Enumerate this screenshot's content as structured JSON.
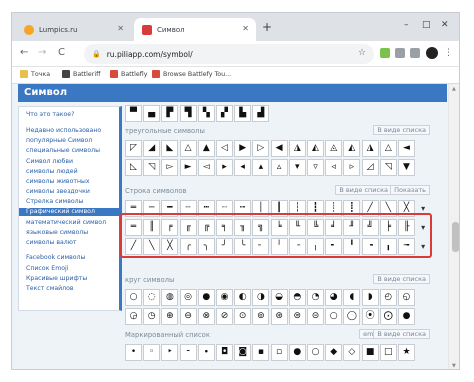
{
  "browser": {
    "tabs": [
      {
        "title": "Lumpics.ru",
        "color": "#f5a623"
      },
      {
        "title": "Символ",
        "color": "#d93a3a"
      }
    ],
    "new_tab": "+",
    "window_controls": [
      "–",
      "□",
      "✕"
    ],
    "close_tab": "✕",
    "nav": {
      "back": "←",
      "forward": "→",
      "reload": "C"
    },
    "address": "ru.piliapp.com/symbol/",
    "bookmarks": [
      "Точка",
      "Battleriff",
      "Battlefly",
      "Browse Battlefy Tou..."
    ]
  },
  "page": {
    "header": "Символ",
    "sidebar": [
      "Что это такое?",
      "Недавно использовано",
      "популярные Символ",
      "специальные символы",
      "Символ любви",
      "символы людей",
      "символы животных",
      "символы звездочки",
      "Стрелка символы",
      "Графический символ",
      "математический символ",
      "языковые символы",
      "символы валют",
      "Facebook символы",
      "Список Emoji",
      "Красивые шрифты",
      "Текст смайлов"
    ],
    "active_sidebar_index": 9,
    "sections": {
      "top": {
        "row": [
          "▀",
          "▄",
          "▛",
          "▜",
          "▚",
          "▞",
          "▙",
          "▟",
          "",
          "",
          "",
          "",
          "",
          "",
          "",
          ""
        ]
      },
      "triangles": {
        "title": "треугольные символы",
        "button": "В виде списка",
        "rows": [
          [
            "◸",
            "◢",
            "◣",
            "△",
            "▲",
            "◁",
            "▶",
            "▷",
            "◀",
            "◮",
            "◭",
            "◬",
            "◭",
            "◮",
            "△",
            "◄"
          ],
          [
            "◺",
            "◹",
            "▻",
            "►",
            "◅",
            "▸",
            "◂",
            "▴",
            "▵",
            "▾",
            "▿",
            "◃",
            "▹",
            "◿",
            "◹",
            "▼"
          ]
        ]
      },
      "lines": {
        "title": "Строка символов",
        "buttons": [
          "В виде списка",
          "Показать"
        ],
        "rows": [
          [
            "═",
            "─",
            "━",
            "┄",
            "┅",
            "┈",
            "┉",
            "│",
            "┃",
            "┆",
            "┇",
            "┊",
            "┋",
            "╱",
            "╲",
            "╳"
          ],
          [
            "═",
            "║",
            "╒",
            "╓",
            "╔",
            "╕",
            "╖",
            "╗",
            "╘",
            "╙",
            "╚",
            "╛",
            "╜",
            "╝",
            "╞",
            "╟"
          ],
          [
            "╱",
            "╲",
            "╳",
            "╭",
            "╮",
            "╯",
            "╰",
            "╴",
            "╵",
            "╶",
            "╷",
            "╸",
            "╹",
            "╺",
            "╻",
            "╼"
          ]
        ],
        "more": "▾"
      },
      "circles": {
        "title": "круг символы",
        "button": "В виде списка",
        "rows": [
          [
            "○",
            "◌",
            "◍",
            "◎",
            "●",
            "◉",
            "◐",
            "◑",
            "◒",
            "◓",
            "◔",
            "◕",
            "◖",
            "◗",
            "◴",
            "◵"
          ],
          [
            "◶",
            "◷",
            "⊕",
            "⊖",
            "⊗",
            "⊘",
            "⊙",
            "⊚",
            "⊛",
            "⊜",
            "⊝",
            "○",
            "◯",
            "⦿",
            "⨀",
            "●"
          ]
        ]
      },
      "marked": {
        "title": "Маркированный список",
        "buttons": [
          "emoji",
          "В виде списка"
        ],
        "row": [
          "•",
          "◦",
          "‣",
          "⁃",
          "∙",
          "◘",
          "◙",
          "▪",
          "▫",
          "●",
          "○",
          "◆",
          "◇",
          "■",
          "□",
          "★"
        ]
      }
    }
  }
}
